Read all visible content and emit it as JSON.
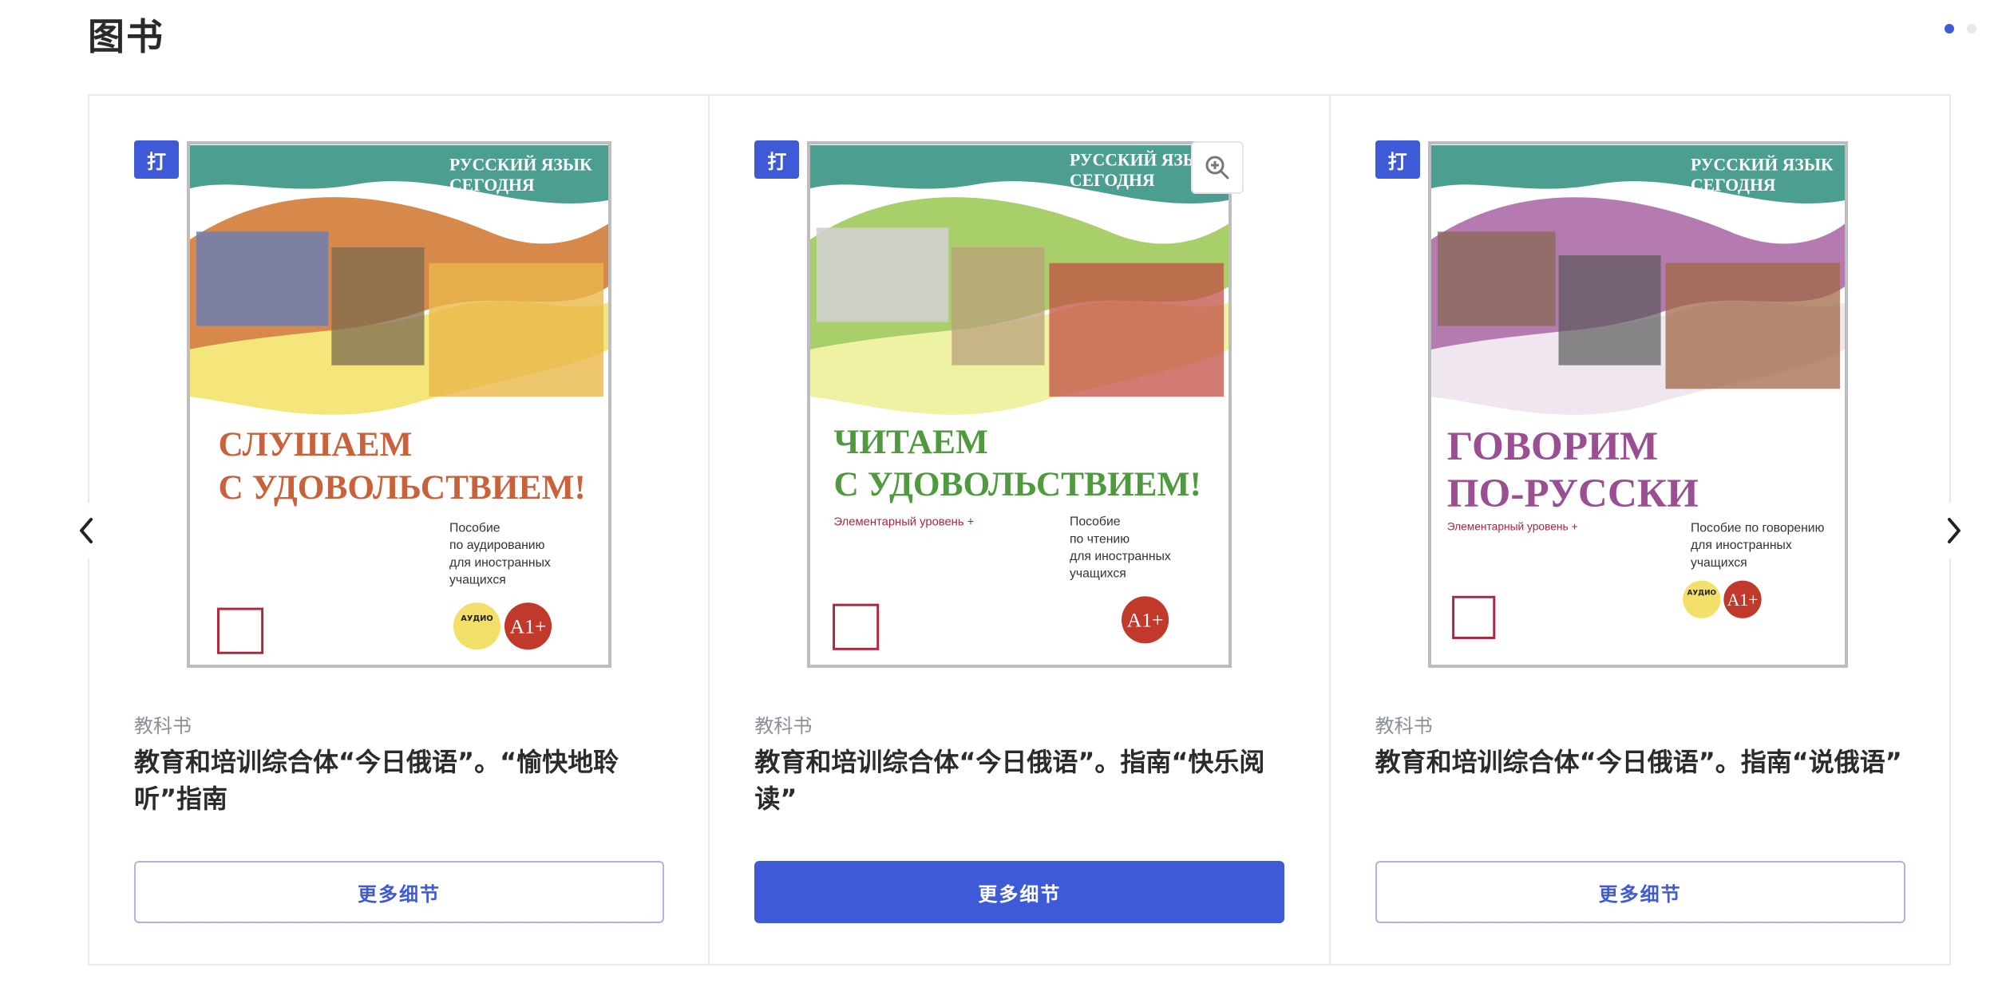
{
  "section": {
    "title": "图书"
  },
  "pagination": {
    "total": 2,
    "active": 0
  },
  "cards": [
    {
      "badge": "打",
      "category": "教科书",
      "title": "教育和培训综合体“今日俄语”。“愉快地聆听”指南",
      "button": "更多细节",
      "button_style": "outline",
      "cover": {
        "series": [
          "РУССКИЙ ЯЗЫК",
          "СЕГОДНЯ"
        ],
        "headline": [
          "СЛУШАЕМ",
          "С УДОВОЛЬСТВИЕМ!"
        ],
        "level_text": "",
        "desc": [
          "Пособие",
          "по аудированию",
          "для иностранных",
          "учащихся"
        ],
        "audio_badge": "АУДИО",
        "level_badge": "A1+",
        "headline_color": "#c9613a",
        "band_color": "#d6894a",
        "band2_color": "#f4e67a"
      }
    },
    {
      "badge": "打",
      "category": "教科书",
      "title": "教育和培训综合体“今日俄语”。指南“快乐阅读”",
      "button": "更多细节",
      "button_style": "primary",
      "cover": {
        "series": [
          "РУССКИЙ ЯЗЫК",
          "СЕГОДНЯ"
        ],
        "headline": [
          "ЧИТАЕМ",
          "С УДОВОЛЬСТВИЕМ!"
        ],
        "level_text": "Элементарный уровень +",
        "desc": [
          "Пособие",
          "по чтению",
          "для иностранных",
          "учащихся"
        ],
        "audio_badge": "",
        "level_badge": "A1+",
        "headline_color": "#4f9a3f",
        "band_color": "#a9cf6a",
        "band2_color": "#eef2a2"
      }
    },
    {
      "badge": "打",
      "category": "教科书",
      "title": "教育和培训综合体“今日俄语”。指南“说俄语”",
      "button": "更多细节",
      "button_style": "outline",
      "cover": {
        "series": [
          "РУССКИЙ ЯЗЫК",
          "СЕГОДНЯ"
        ],
        "headline": [
          "ГОВОРИМ",
          "ПО-РУССКИ"
        ],
        "level_text": "Элементарный уровень +",
        "desc": [
          "Пособие по говорению",
          "для иностранных",
          "учащихся"
        ],
        "audio_badge": "АУДИО",
        "level_badge": "A1+",
        "headline_color": "#9a4f93",
        "band_color": "#b57bb0",
        "band2_color": "#efe6f0"
      }
    }
  ],
  "colors": {
    "accent": "#3f5ad6",
    "teal": "#4c9e91",
    "level_red": "#c0392b"
  },
  "icons": {
    "prev": "chevron-left-icon",
    "next": "chevron-right-icon",
    "zoom": "zoom-in-icon"
  }
}
